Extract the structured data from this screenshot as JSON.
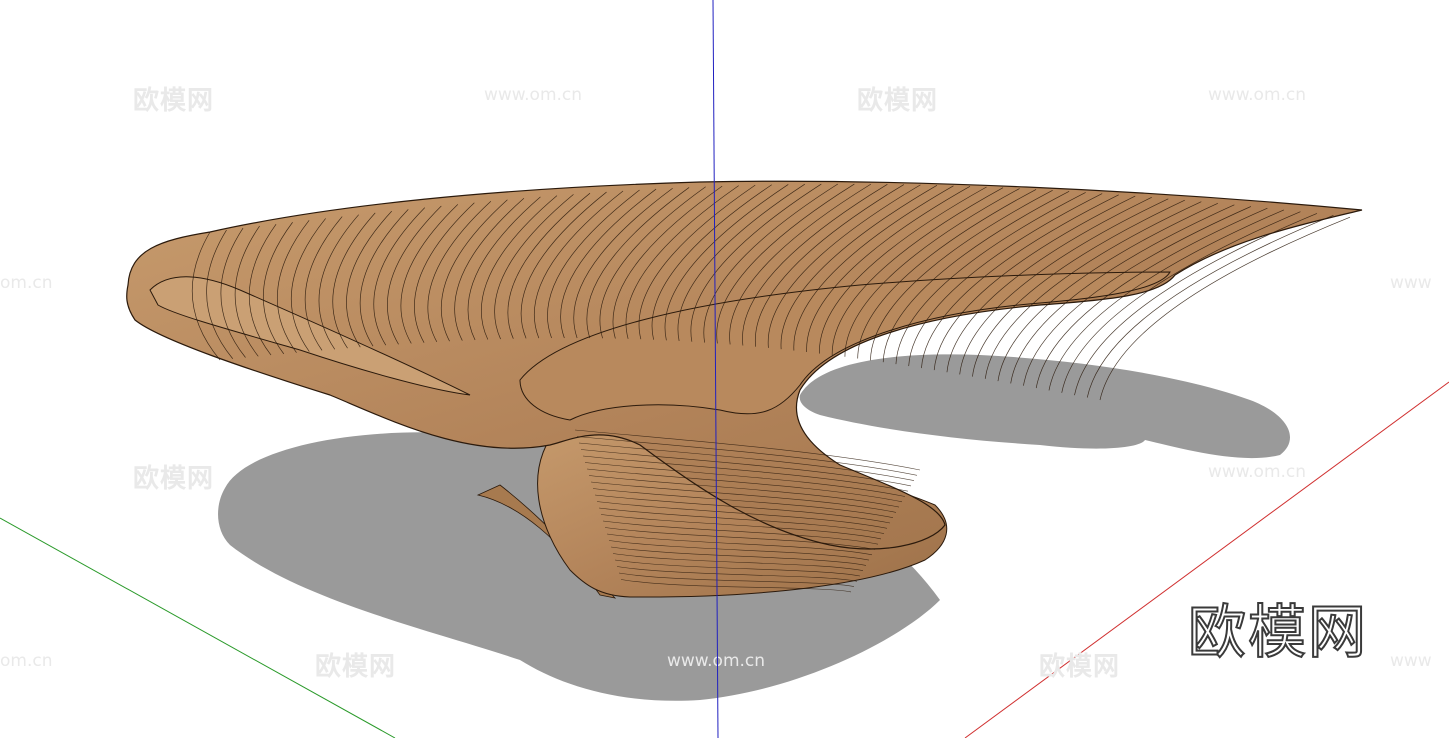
{
  "scene": {
    "background": "#ffffff",
    "object": "parametric wooden bench",
    "wood_colors": {
      "base": "#b6875a",
      "light": "#cfa57a",
      "dark": "#8a6138",
      "slat_line": "#2b1a0c"
    },
    "shadow_color": "#9a9a9a",
    "axes": {
      "red": "#d03030",
      "green": "#2a9a2a",
      "blue": "#2020c0"
    }
  },
  "watermarks": {
    "logo_text": "欧模网",
    "url_text": "www.om.cn",
    "url_text_partial": "om.cn",
    "url_text_clipped": "www"
  },
  "brand": {
    "text": "欧模网"
  }
}
